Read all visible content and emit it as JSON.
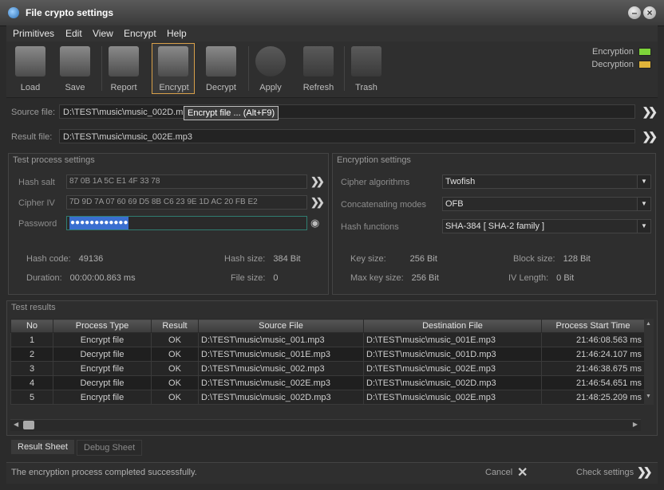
{
  "window": {
    "title": "File crypto settings",
    "minimize": "–",
    "close": "×"
  },
  "menu": [
    "Primitives",
    "Edit",
    "View",
    "Encrypt",
    "Help"
  ],
  "toolbar": {
    "load": "Load",
    "save": "Save",
    "report": "Report",
    "encrypt": "Encrypt",
    "decrypt": "Decrypt",
    "apply": "Apply",
    "refresh": "Refresh",
    "trash": "Trash"
  },
  "status_legend": {
    "encryption": "Encryption",
    "decryption": "Decryption",
    "encryption_color": "#7ed43a",
    "decryption_color": "#e0b43a"
  },
  "source": {
    "label": "Source file:",
    "value": "D:\\TEST\\music\\music_002D.mp3"
  },
  "result": {
    "label": "Result file:",
    "value": "D:\\TEST\\music\\music_002E.mp3"
  },
  "tooltip": "Encrypt file ... (Alt+F9)",
  "test_process": {
    "title": "Test process settings",
    "hash_salt_label": "Hash salt",
    "hash_salt": "87 0B 1A 5C E1 4F 33 78",
    "cipher_iv_label": "Cipher IV",
    "cipher_iv": "7D 9D 7A 07 60 69 D5 8B C6 23 9E 1D AC 20 FB E2",
    "password_label": "Password",
    "password": "●●●●●●●●●●●●",
    "hash_code_label": "Hash code:",
    "hash_code": "49136",
    "hash_size_label": "Hash size:",
    "hash_size": "384 Bit",
    "duration_label": "Duration:",
    "duration": "00:00:00.863 ms",
    "file_size_label": "File size:",
    "file_size": "0"
  },
  "encryption": {
    "title": "Encryption settings",
    "cipher_label": "Cipher algorithms",
    "cipher": "Twofish",
    "mode_label": "Concatenating modes",
    "mode": "OFB",
    "hash_label": "Hash functions",
    "hash": "SHA-384 [ SHA-2 family ]",
    "key_size_label": "Key size:",
    "key_size": "256 Bit",
    "block_size_label": "Block size:",
    "block_size": "128 Bit",
    "max_key_label": "Max key size:",
    "max_key": "256 Bit",
    "iv_length_label": "IV Length:",
    "iv_length": "0 Bit"
  },
  "results": {
    "title": "Test results",
    "columns": [
      "No",
      "Process Type",
      "Result",
      "Source File",
      "Destination File",
      "Process Start Time"
    ],
    "rows": [
      [
        "1",
        "Encrypt file",
        "OK",
        "D:\\TEST\\music\\music_001.mp3",
        "D:\\TEST\\music\\music_001E.mp3",
        "21:46:08.563 ms"
      ],
      [
        "2",
        "Decrypt file",
        "OK",
        "D:\\TEST\\music\\music_001E.mp3",
        "D:\\TEST\\music\\music_001D.mp3",
        "21:46:24.107 ms"
      ],
      [
        "3",
        "Encrypt file",
        "OK",
        "D:\\TEST\\music\\music_002.mp3",
        "D:\\TEST\\music\\music_002E.mp3",
        "21:46:38.675 ms"
      ],
      [
        "4",
        "Decrypt file",
        "OK",
        "D:\\TEST\\music\\music_002E.mp3",
        "D:\\TEST\\music\\music_002D.mp3",
        "21:46:54.651 ms"
      ],
      [
        "5",
        "Encrypt file",
        "OK",
        "D:\\TEST\\music\\music_002D.mp3",
        "D:\\TEST\\music\\music_002E.mp3",
        "21:48:25.209 ms"
      ]
    ]
  },
  "tabs": {
    "result_sheet": "Result Sheet",
    "debug_sheet": "Debug Sheet"
  },
  "statusbar": {
    "message": "The encryption process completed successfully.",
    "cancel": "Cancel",
    "check": "Check settings"
  }
}
